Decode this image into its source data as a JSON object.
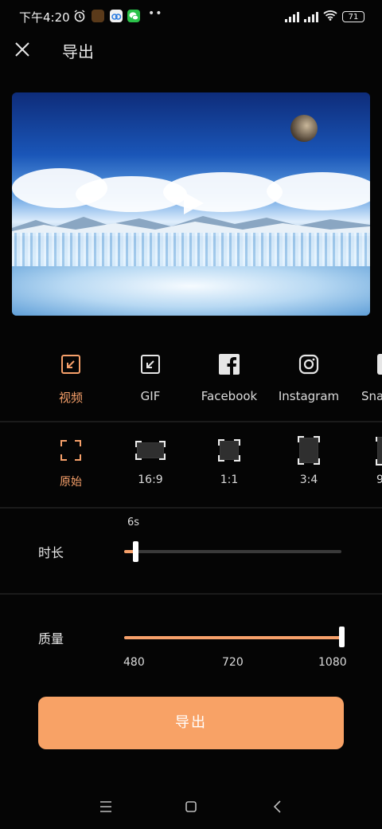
{
  "status_bar": {
    "time": "下午4:20",
    "battery": "71"
  },
  "header": {
    "title": "导出"
  },
  "export_types": [
    {
      "label": "视频",
      "icon": "export-video-icon",
      "active": true
    },
    {
      "label": "GIF",
      "icon": "export-gif-icon",
      "active": false
    },
    {
      "label": "Facebook",
      "icon": "facebook-icon",
      "active": false
    },
    {
      "label": "Instagram",
      "icon": "instagram-icon",
      "active": false
    },
    {
      "label": "Sna",
      "icon": "snapchat-icon",
      "active": false
    }
  ],
  "ratios": [
    {
      "label": "原始",
      "active": true
    },
    {
      "label": "16:9",
      "active": false
    },
    {
      "label": "1:1",
      "active": false
    },
    {
      "label": "3:4",
      "active": false
    },
    {
      "label": "9",
      "active": false
    }
  ],
  "duration": {
    "label": "时长",
    "value": "6s",
    "fraction": 0.05
  },
  "quality": {
    "label": "质量",
    "ticks": [
      "480",
      "720",
      "1080"
    ],
    "selected": "1080",
    "fraction": 1.0
  },
  "export_button": {
    "label": "导出"
  },
  "colors": {
    "accent": "#f6a06a",
    "button": "#f8a266",
    "background": "#050505"
  }
}
